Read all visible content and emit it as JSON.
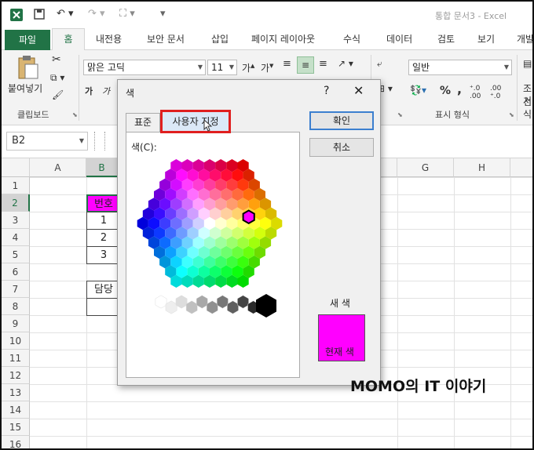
{
  "titlebar": {
    "app_icon": "excel-icon",
    "title": "통합 문서3  -  Excel"
  },
  "tabs": [
    {
      "label": "파일"
    },
    {
      "label": "홈"
    },
    {
      "label": "삽입"
    },
    {
      "label": "페이지 레이아웃"
    },
    {
      "label": "수식"
    },
    {
      "label": "데이터"
    },
    {
      "label": "검토"
    },
    {
      "label": "보기"
    },
    {
      "label": "개발"
    }
  ],
  "tabs_extra": {
    "sheet_label": "내전용",
    "security_label": "보안 문서"
  },
  "ribbon": {
    "paste_label": "붙여넣기",
    "clipboard_label": "클립보드",
    "font_name": "맑은 고딕",
    "font_size": "11",
    "number_format": "일반",
    "number_group_label": "표시 형식",
    "percent": "%",
    "comma": ",",
    "cond_label": "조건",
    "cell_style_label": "서식"
  },
  "formula_bar": {
    "name_box": "B2"
  },
  "columns": [
    "A",
    "B",
    "G",
    "H"
  ],
  "rows": [
    "1",
    "2",
    "3",
    "4",
    "5",
    "6",
    "7",
    "8",
    "9",
    "10",
    "11",
    "12",
    "13",
    "14",
    "15",
    "16"
  ],
  "cells": {
    "b2": "번호",
    "b3": "1",
    "b4": "2",
    "b5": "3",
    "b7": "담당"
  },
  "dialog": {
    "title": "색",
    "help": "?",
    "close": "✕",
    "tab_standard": "표준",
    "tab_custom": "사용자 지정",
    "colors_label": "색(C):",
    "ok": "확인",
    "cancel": "취소",
    "new_label": "새 색",
    "current_label": "현재 색",
    "selected_color": "#ff00ff"
  },
  "watermark": "MOMO의 IT 이야기",
  "colors": {
    "excel_green": "#217346",
    "highlight": "#e01f1f",
    "magenta": "#ff00ff"
  }
}
